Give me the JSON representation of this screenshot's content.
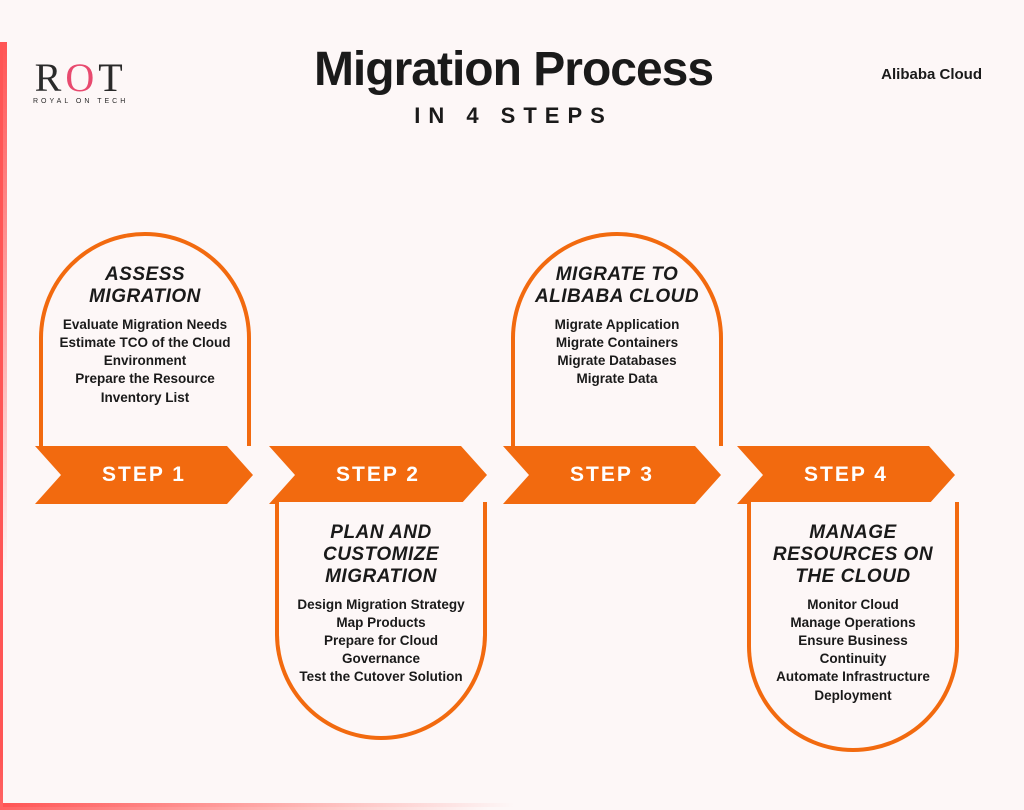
{
  "logo": {
    "main_left": "R",
    "main_mid": "O",
    "main_right": "T",
    "sub": "ROYAL ON TECH"
  },
  "top_right": "Alibaba Cloud",
  "title": "Migration Process",
  "subtitle": "IN 4 STEPS",
  "steps": [
    {
      "label": "STEP 1",
      "heading": "ASSESS MIGRATION",
      "body": "Evaluate Migration Needs\nEstimate TCO of the Cloud Environment\nPrepare the Resource Inventory List"
    },
    {
      "label": "STEP 2",
      "heading": "PLAN AND CUSTOMIZE MIGRATION",
      "body": "Design Migration Strategy\nMap Products\nPrepare for Cloud Governance\nTest the Cutover Solution"
    },
    {
      "label": "STEP 3",
      "heading": "MIGRATE TO ALIBABA CLOUD",
      "body": "Migrate Application\nMigrate Containers\nMigrate Databases\nMigrate Data"
    },
    {
      "label": "STEP 4",
      "heading": "MANAGE RESOURCES ON THE CLOUD",
      "body": "Monitor Cloud\nManage Operations\nEnsure Business Continuity\nAutomate Infrastructure Deployment"
    }
  ]
}
